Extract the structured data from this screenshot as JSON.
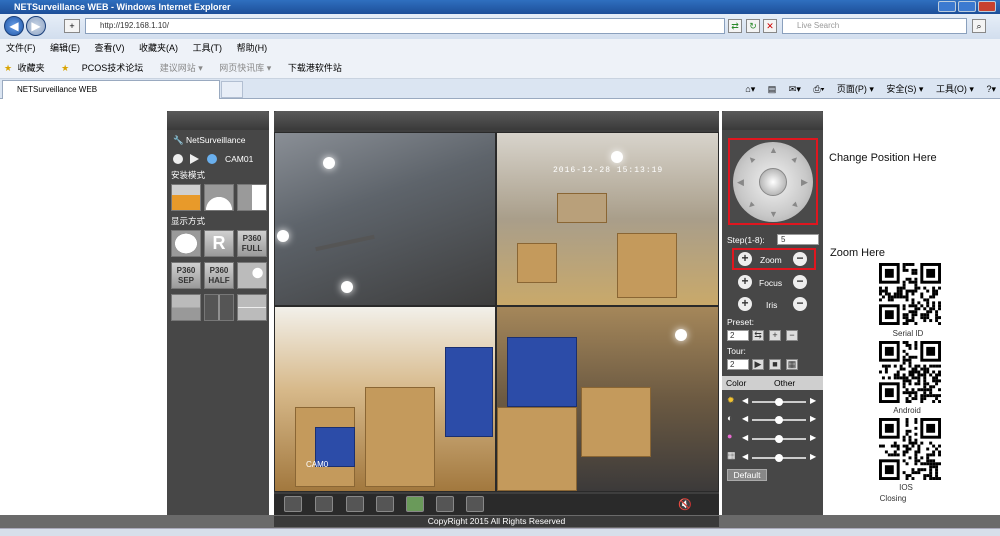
{
  "browser": {
    "title": "NETSurveillance WEB - Windows Internet Explorer",
    "address": "http://192.168.1.10/",
    "search_placeholder": "Live Search",
    "menu": [
      "文件(F)",
      "编辑(E)",
      "查看(V)",
      "收藏夹(A)",
      "工具(T)",
      "帮助(H)"
    ],
    "favorites_label": "收藏夹",
    "favorites": [
      "PCOS技术论坛",
      "建议网站 ▾",
      "网页快讯库 ▾",
      "下载港软件站"
    ],
    "tab_title": "NETSurveillance WEB",
    "commands": [
      "页面(P) ▾",
      "安全(S) ▾",
      "工具(O) ▾"
    ]
  },
  "left_panel": {
    "brand": "NetSurveillance",
    "camera": "CAM01",
    "install_mode_label": "安装模式",
    "display_mode_label": "显示方式",
    "mode_buttons": [
      "P360\nFULL",
      "P360\nSEP",
      "P360\nHALF",
      "R"
    ]
  },
  "video": {
    "timestamp": "2016-12-28 15:13:19",
    "camera_label": "CAM0"
  },
  "ptz": {
    "step_label": "Step(1-8):",
    "step_value": "5",
    "zoom_label": "Zoom",
    "focus_label": "Focus",
    "iris_label": "Iris",
    "preset_label": "Preset:",
    "preset_value": "2",
    "tour_label": "Tour:",
    "tour_value": "2",
    "tab_color": "Color",
    "tab_other": "Other",
    "default_button": "Default",
    "slider_levels": [
      0.5,
      0.5,
      0.5,
      0.5
    ]
  },
  "annotations": {
    "change_position": "Change Position Here",
    "zoom_here": "Zoom Here"
  },
  "qr_codes": {
    "serial": "Serial ID",
    "android": "Android",
    "ios": "IOS",
    "closing": "Closing"
  },
  "footer": {
    "copyright": "CopyRight 2015 All Rights Reserved"
  },
  "colors": {
    "highlight": "#e0161f",
    "panel": "#474747"
  }
}
